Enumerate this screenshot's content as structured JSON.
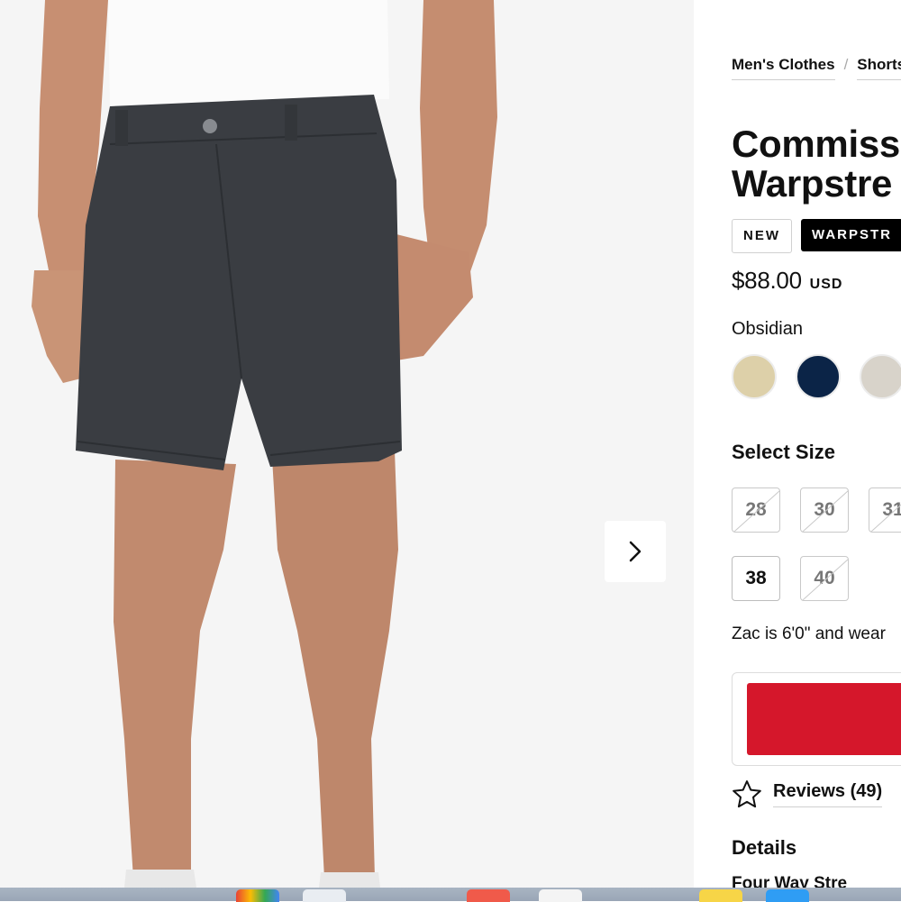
{
  "breadcrumb": {
    "items": [
      "Men's Clothes",
      "Shorts"
    ],
    "separator": "/"
  },
  "product": {
    "title_line1": "Commiss",
    "title_line2": "Warpstre",
    "badges": [
      "NEW",
      "WARPSTR"
    ],
    "price": "$88.00",
    "currency": "USD",
    "color_name": "Obsidian",
    "swatch_colors": [
      "#ddd0a9",
      "#0b2447",
      "#d8d3ca"
    ]
  },
  "sizes": {
    "label": "Select Size",
    "row1": [
      {
        "label": "28",
        "available": false
      },
      {
        "label": "30",
        "available": false
      },
      {
        "label": "31",
        "available": false
      }
    ],
    "row2": [
      {
        "label": "38",
        "available": true
      },
      {
        "label": "40",
        "available": false
      }
    ]
  },
  "fit_note": "Zac is 6'0\" and wear",
  "reviews": {
    "label": "Reviews",
    "count": "(49)"
  },
  "details": {
    "heading": "Details",
    "first_feature": "Four Way Stre"
  },
  "colors": {
    "cart_red": "#d5172b",
    "image_bg": "#f5f5f5",
    "short_fabric": "#3a3d42"
  },
  "icons": [
    "chevron-right-icon",
    "star-outline-icon"
  ]
}
